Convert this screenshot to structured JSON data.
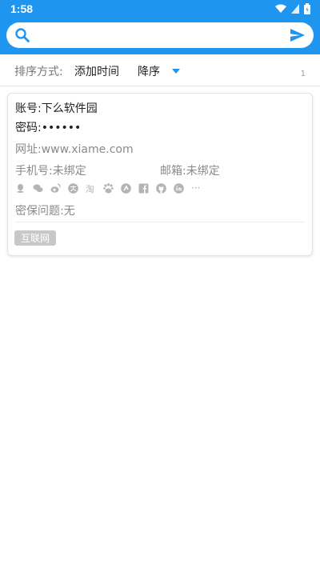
{
  "status_bar": {
    "time": "1:58"
  },
  "search": {
    "placeholder": ""
  },
  "sort": {
    "label": "排序方式:",
    "field": "添加时间",
    "order": "降序"
  },
  "list": {
    "count": "1"
  },
  "entry": {
    "account_label": "账号:",
    "account_value": "下么软件园",
    "password_label": "密码:",
    "password_value": "••••••",
    "url_label": "网址:",
    "url_value": "www.xiame.com",
    "phone_label": "手机号:",
    "phone_value": "未绑定",
    "email_label": "邮箱:",
    "email_value": "未绑定",
    "security_label": "密保问题:",
    "security_value": "无",
    "tag": "互联网",
    "social_icons": [
      "qq-icon",
      "wechat-icon",
      "weibo-icon",
      "alipay-icon",
      "taobao-icon",
      "baidu-icon",
      "douban-icon",
      "facebook-icon",
      "github-icon",
      "linkedin-icon",
      "more-icon"
    ]
  },
  "colors": {
    "accent": "#1e96f0",
    "tag_bg": "#c8c8c8",
    "icon_gray": "#b4b4b4"
  }
}
